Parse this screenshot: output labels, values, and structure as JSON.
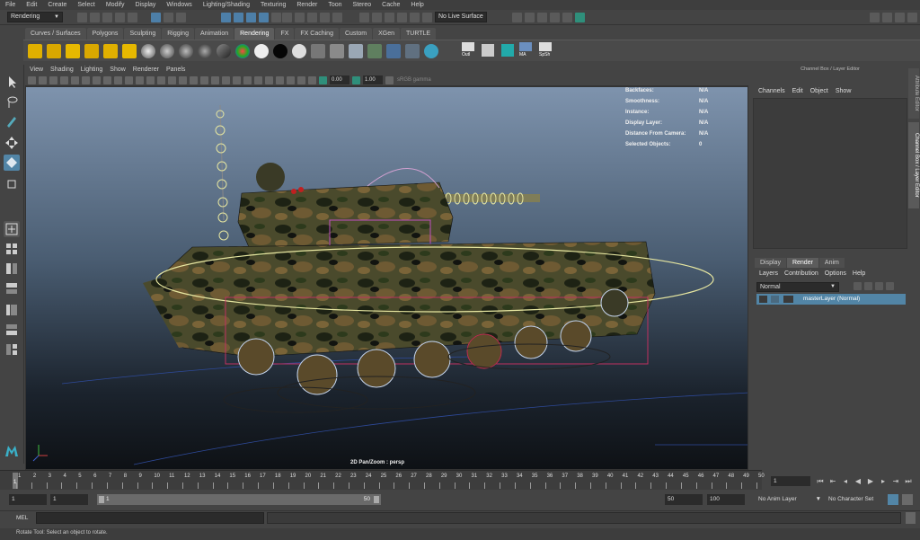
{
  "menubar": [
    "File",
    "Edit",
    "Create",
    "Select",
    "Modify",
    "Display",
    "Windows",
    "Lighting/Shading",
    "Texturing",
    "Render",
    "Toon",
    "Stereo",
    "Cache",
    "Help"
  ],
  "statusline": {
    "mode": "Rendering",
    "live_surface": "No Live Surface"
  },
  "shelf": {
    "tabs": [
      "Curves / Surfaces",
      "Polygons",
      "Sculpting",
      "Rigging",
      "Animation",
      "Rendering",
      "FX",
      "FX Caching",
      "Custom",
      "XGen",
      "TURTLE"
    ],
    "active_tab": "Rendering",
    "button_labels": [
      "Outl",
      "MA",
      "SpSh"
    ]
  },
  "viewport": {
    "panel_menu": [
      "View",
      "Shading",
      "Lighting",
      "Show",
      "Renderer",
      "Panels"
    ],
    "fields": [
      "0.00",
      "1.00"
    ],
    "color_space": "sRGB gamma",
    "hud": [
      {
        "label": "Backfaces:",
        "value": "N/A"
      },
      {
        "label": "Smoothness:",
        "value": "N/A"
      },
      {
        "label": "Instance:",
        "value": "N/A"
      },
      {
        "label": "Display Layer:",
        "value": "N/A"
      },
      {
        "label": "Distance From Camera:",
        "value": "N/A"
      },
      {
        "label": "Selected Objects:",
        "value": "0"
      }
    ],
    "camera_label": "2D Pan/Zoom : persp"
  },
  "channel_box": {
    "title": "Channel Box / Layer Editor",
    "menus": [
      "Channels",
      "Edit",
      "Object",
      "Show"
    ]
  },
  "side_tabs": [
    "Attribute Editor",
    "Channel Box / Layer Editor"
  ],
  "layer_editor": {
    "tabs": [
      "Display",
      "Render",
      "Anim"
    ],
    "active_tab": "Render",
    "menus": [
      "Layers",
      "Contribution",
      "Options",
      "Help"
    ],
    "blend_mode": "Normal",
    "layers": [
      {
        "name": "masterLayer (Normal)"
      }
    ]
  },
  "timeline": {
    "ticks": [
      "1",
      "2",
      "3",
      "4",
      "5",
      "6",
      "7",
      "8",
      "9",
      "10",
      "11",
      "12",
      "13",
      "14",
      "15",
      "16",
      "17",
      "18",
      "19",
      "20",
      "21",
      "22",
      "23",
      "24",
      "25",
      "26",
      "27",
      "28",
      "29",
      "30",
      "31",
      "32",
      "33",
      "34",
      "35",
      "36",
      "37",
      "38",
      "39",
      "40",
      "41",
      "42",
      "43",
      "44",
      "45",
      "46",
      "47",
      "48",
      "49",
      "50"
    ],
    "current_frame": "1",
    "playhead": "1"
  },
  "range": {
    "start": "1",
    "playback_start": "1",
    "slider_low": "1",
    "slider_high": "50",
    "playback_end": "50",
    "end": "100",
    "anim_layer": "No Anim Layer",
    "character_set": "No Character Set"
  },
  "command_line": {
    "label": "MEL"
  },
  "help_line": "Rotate Tool: Select an object to rotate."
}
